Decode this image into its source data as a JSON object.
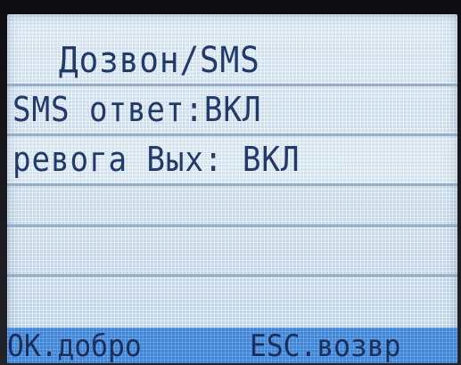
{
  "screen": {
    "title": "Дозвон/SMS",
    "menu_items": [
      {
        "label": "SMS ответ:ВКЛ",
        "selected": false
      },
      {
        "label": "ревога Вых: ВКЛ",
        "selected": true
      },
      {
        "label": "",
        "selected": false
      },
      {
        "label": "",
        "selected": false
      },
      {
        "label": "",
        "selected": false
      }
    ],
    "softkeys": {
      "left": "OK.добро",
      "right": "ESC.возвр"
    },
    "colors": {
      "lcd_background": "#c4d9ea",
      "lcd_text": "#233a68",
      "softkey_bar": "#3f86d8"
    }
  }
}
